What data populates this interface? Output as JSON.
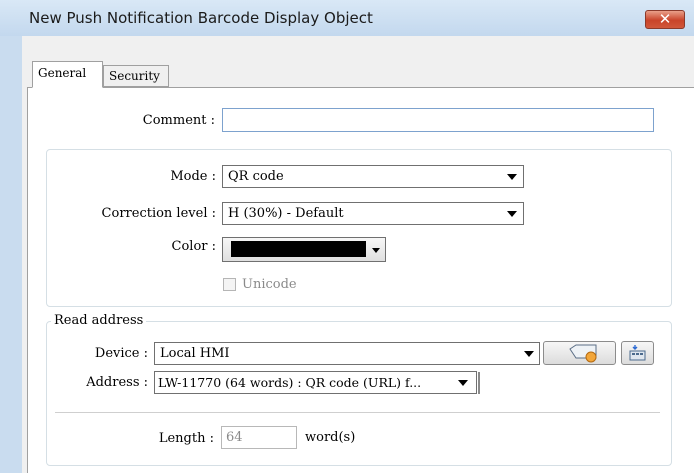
{
  "window": {
    "title": "New Push Notification Barcode Display Object",
    "close_glyph": "✕"
  },
  "tabs": [
    {
      "label": "General"
    },
    {
      "label": "Security"
    }
  ],
  "comment": {
    "label": "Comment :",
    "value": ""
  },
  "mode": {
    "label": "Mode :",
    "value": "QR code"
  },
  "correction": {
    "label": "Correction level :",
    "value": "H (30%) - Default"
  },
  "color": {
    "label": "Color :",
    "swatch": "#000000"
  },
  "unicode": {
    "label": "Unicode",
    "checked": false,
    "enabled": false
  },
  "read_address": {
    "legend": "Read address",
    "device": {
      "label": "Device :",
      "value": "Local HMI"
    },
    "address": {
      "label": "Address :",
      "value": "LW-11770 (64 words) : QR code (URL) f..."
    },
    "length": {
      "label": "Length :",
      "value": "64",
      "unit": "word(s)"
    }
  },
  "colors": {
    "accent": "#7da2ce",
    "close": "#c9442a"
  }
}
